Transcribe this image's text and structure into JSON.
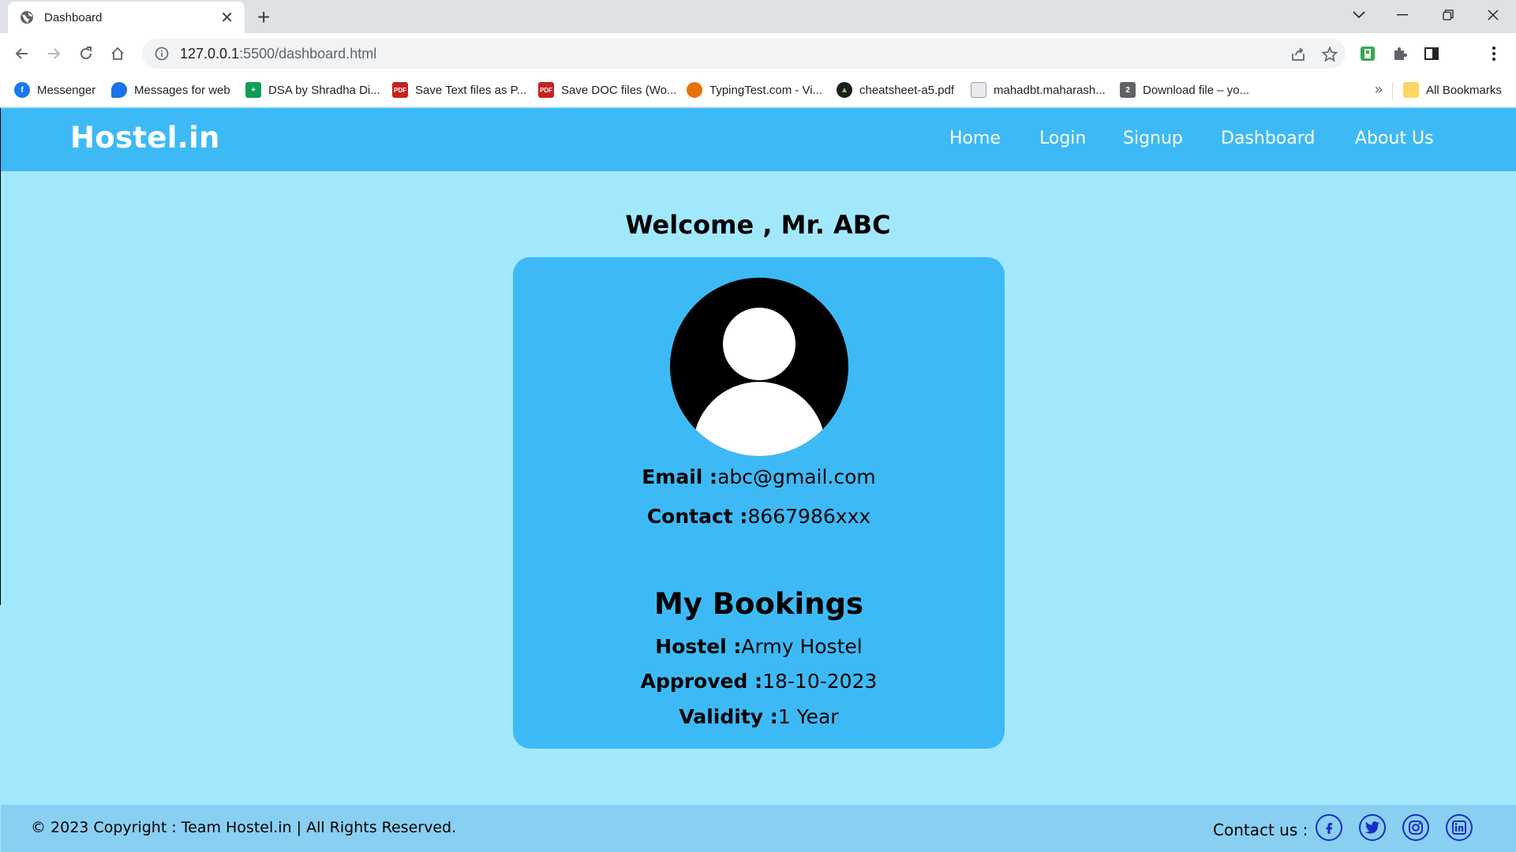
{
  "browser": {
    "tab_title": "Dashboard",
    "url_host": "127.0.0.1",
    "url_path": ":5500/dashboard.html",
    "bookmarks": [
      {
        "label": "Messenger",
        "icon": "facebook-icon",
        "color": "#1877f2"
      },
      {
        "label": "Messages for web",
        "icon": "messages-icon",
        "color": "#1a73e8"
      },
      {
        "label": "DSA by Shradha Di...",
        "icon": "sheets-icon",
        "color": "#0f9d58"
      },
      {
        "label": "Save Text files as P...",
        "icon": "pdf-icon",
        "color": "#c5221f"
      },
      {
        "label": "Save DOC files (Wo...",
        "icon": "pdf-icon",
        "color": "#c5221f"
      },
      {
        "label": "TypingTest.com - Vi...",
        "icon": "typingtest-icon",
        "color": "#e8710a"
      },
      {
        "label": "cheatsheet-a5.pdf",
        "icon": "cheatsheet-icon",
        "color": "#1e1e1e"
      },
      {
        "label": "mahadbt.maharash...",
        "icon": "document-icon",
        "color": "#9aa0a6"
      },
      {
        "label": "Download file – yo...",
        "icon": "download-file-icon",
        "color": "#5f6368"
      }
    ],
    "all_bookmarks": "All Bookmarks"
  },
  "site": {
    "brand": "Hostel.in",
    "nav": [
      "Home",
      "Login",
      "Signup",
      "Dashboard",
      "About Us"
    ],
    "primary_color": "#3dbaf6",
    "background_color": "#a2e8fd"
  },
  "dashboard": {
    "welcome": "Welcome , Mr. ABC",
    "email_label": "Email :",
    "email_value": "abc@gmail.com",
    "contact_label": "Contact :",
    "contact_value": "8667986xxx",
    "bookings_title": "My Bookings",
    "hostel_label": "Hostel :",
    "hostel_value": "Army Hostel",
    "approved_label": "Approved :",
    "approved_value": "18-10-2023",
    "validity_label": "Validity :",
    "validity_value": "1 Year"
  },
  "footer": {
    "copyright": "© 2023 Copyright : Team Hostel.in | All Rights Reserved.",
    "contact_label": "Contact us :",
    "social": [
      "facebook-icon",
      "twitter-icon",
      "instagram-icon",
      "linkedin-icon"
    ],
    "social_color": "#1a2cc8"
  }
}
